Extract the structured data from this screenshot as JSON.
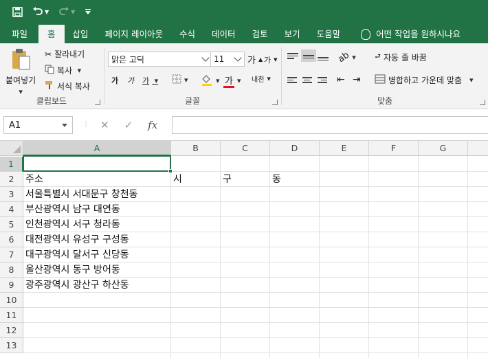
{
  "colors": {
    "brand": "#217346",
    "ribbon_bg": "#f3f3f3"
  },
  "quick_access": {
    "save_icon": "save-icon",
    "undo_icon": "undo-icon",
    "redo_icon": "redo-icon",
    "customize_icon": "customize-icon"
  },
  "tabs": [
    {
      "label": "파일"
    },
    {
      "label": "홈"
    },
    {
      "label": "삽입"
    },
    {
      "label": "페이지 레이아웃"
    },
    {
      "label": "수식"
    },
    {
      "label": "데이터"
    },
    {
      "label": "검토"
    },
    {
      "label": "보기"
    },
    {
      "label": "도움말"
    }
  ],
  "tell_me": "어떤 작업을 원하시나요",
  "clipboard": {
    "paste": "붙여넣기",
    "cut": "잘라내기",
    "copy": "복사",
    "format_painter": "서식 복사",
    "label": "클립보드"
  },
  "font": {
    "name": "맑은 고딕",
    "size": "11",
    "label": "글꼴",
    "grow": "가",
    "shrink": "가",
    "bold": "가",
    "italic": "가",
    "underline": "가",
    "color_letter": "가",
    "phonetic": "내천"
  },
  "alignment": {
    "wrap_text": "자동 줄 바꿈",
    "merge_center": "병합하고 가운데 맞춤",
    "label": "맞춤"
  },
  "formula_bar": {
    "name_box": "A1",
    "fx": "fx",
    "cancel": "✕",
    "enter": "✓",
    "value": ""
  },
  "columns": [
    "A",
    "B",
    "C",
    "D",
    "E",
    "F",
    "G"
  ],
  "rows": [
    "1",
    "2",
    "3",
    "4",
    "5",
    "6",
    "7",
    "8",
    "9",
    "10",
    "11",
    "12",
    "13"
  ],
  "cells": {
    "A2": "주소",
    "B2": "시",
    "C2": "구",
    "D2": "동",
    "A3": "서울특별시 서대문구 창천동",
    "A4": "부산광역시 남구 대연동",
    "A5": "인천광역시 서구 청라동",
    "A6": "대전광역시 유성구 구성동",
    "A7": "대구광역시 달서구 신당동",
    "A8": "울산광역시 동구 방어동",
    "A9": "광주광역시 광산구 하산동"
  }
}
